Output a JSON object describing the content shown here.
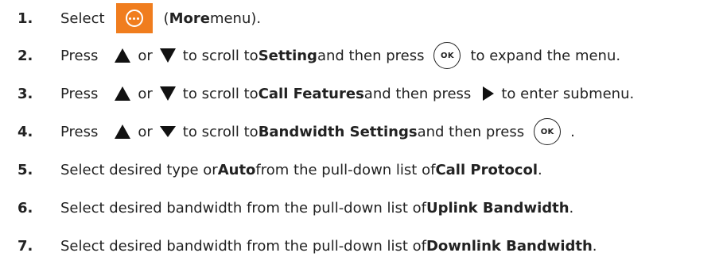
{
  "steps": [
    {
      "num": "1.",
      "t1": "Select",
      "t2": "(",
      "b1": "More",
      "t3": " menu)."
    },
    {
      "num": "2.",
      "t1": "Press",
      "t2": "or",
      "t3": "to scroll to ",
      "b1": "Setting",
      "t4": " and then press",
      "t5": "to expand the menu."
    },
    {
      "num": "3.",
      "t1": "Press",
      "t2": "or",
      "t3": "to scroll to ",
      "b1": "Call Features",
      "t4": " and then press",
      "t5": "to enter submenu."
    },
    {
      "num": "4.",
      "t1": "Press",
      "t2": "or",
      "t3": "to scroll to ",
      "b1": "Bandwidth Settings",
      "t4": " and then press",
      "t5": "."
    },
    {
      "num": "5.",
      "t1": "Select desired type or ",
      "b1": "Auto",
      "t2": " from the pull-down list of ",
      "b2": "Call Protocol",
      "t3": "."
    },
    {
      "num": "6.",
      "t1": "Select desired bandwidth from the pull-down list of ",
      "b1": "Uplink Bandwidth",
      "t2": "."
    },
    {
      "num": "7.",
      "t1": "Select desired bandwidth from the pull-down list of ",
      "b1": "Downlink Bandwidth",
      "t2": "."
    }
  ],
  "ok_label": "OK",
  "icons": {
    "more": "more-icon",
    "up": "up-arrow-icon",
    "down": "down-arrow-icon",
    "right": "right-arrow-icon",
    "ok": "ok-button-icon"
  },
  "colors": {
    "more_button": "#f07d1e",
    "text": "#222222"
  }
}
